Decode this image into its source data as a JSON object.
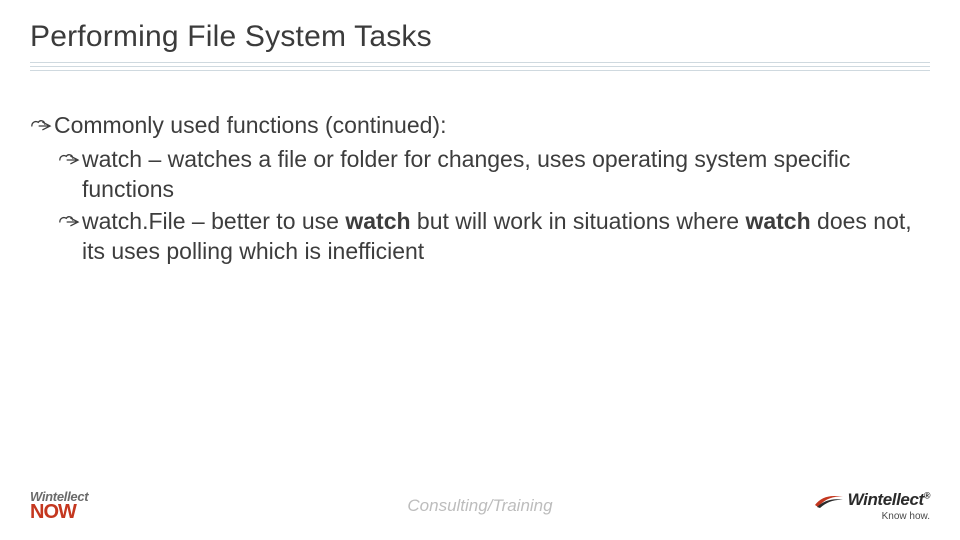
{
  "title": "Performing File System Tasks",
  "bullets": {
    "lvl1_text": "Commonly used functions (continued):",
    "item1": {
      "lead": "watch – ",
      "rest": "watches a file or folder for changes, uses operating system specific functions"
    },
    "item2": {
      "lead": "watch.File – better to use ",
      "bold1": "watch",
      "mid": " but will work in situations where ",
      "bold2": "watch",
      "rest": " does not, its uses polling which is inefficient"
    }
  },
  "footer": {
    "center": "Consulting/Training",
    "left_top": "Wintellect",
    "left_bottom": "NOW",
    "right_brand": "Wintellect",
    "right_reg": "®",
    "right_tag": "Know how."
  }
}
